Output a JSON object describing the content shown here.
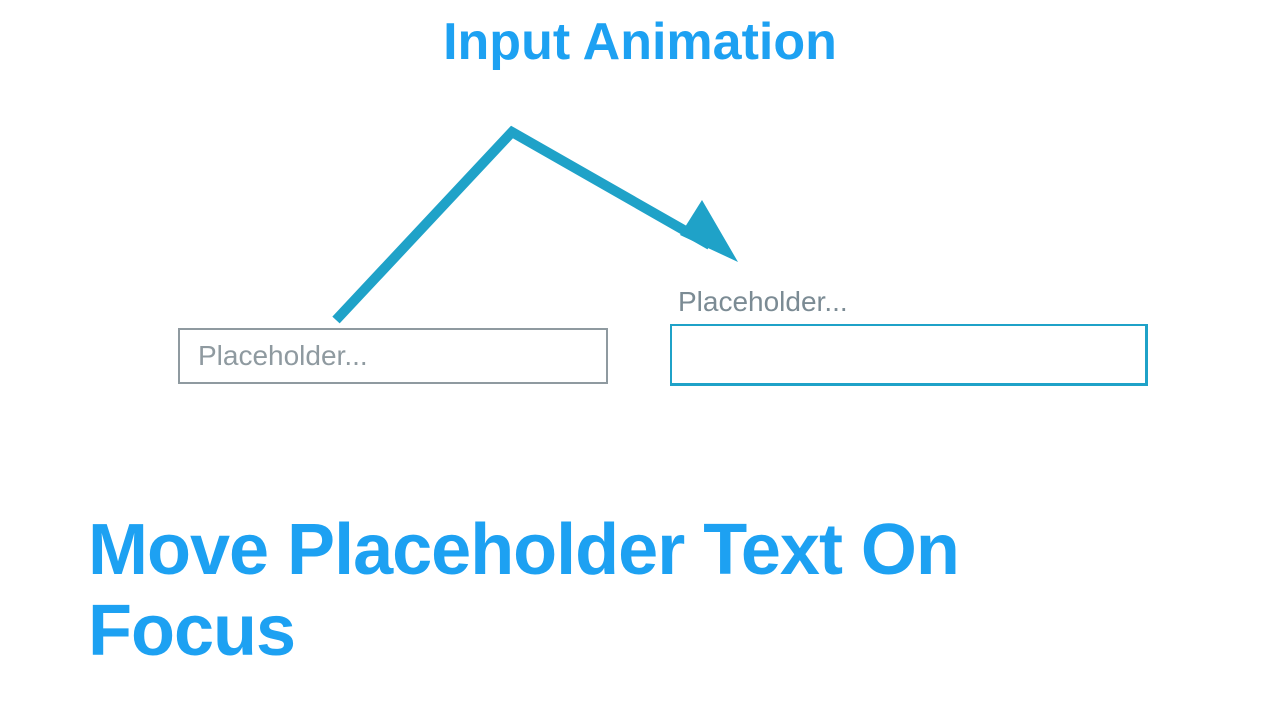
{
  "title": "Input Animation",
  "subtitle_line1": "Move Placeholder Text On",
  "subtitle_line2": "Focus",
  "left_input": {
    "placeholder": "Placeholder..."
  },
  "right_input": {
    "floating_label": "Placeholder...",
    "value": ""
  },
  "colors": {
    "accent": "#1da1f2",
    "border_default": "#8f9aa0",
    "border_focused": "#1fa2c8",
    "placeholder_text": "#8f9aa0",
    "label_text": "#7b8b94"
  }
}
